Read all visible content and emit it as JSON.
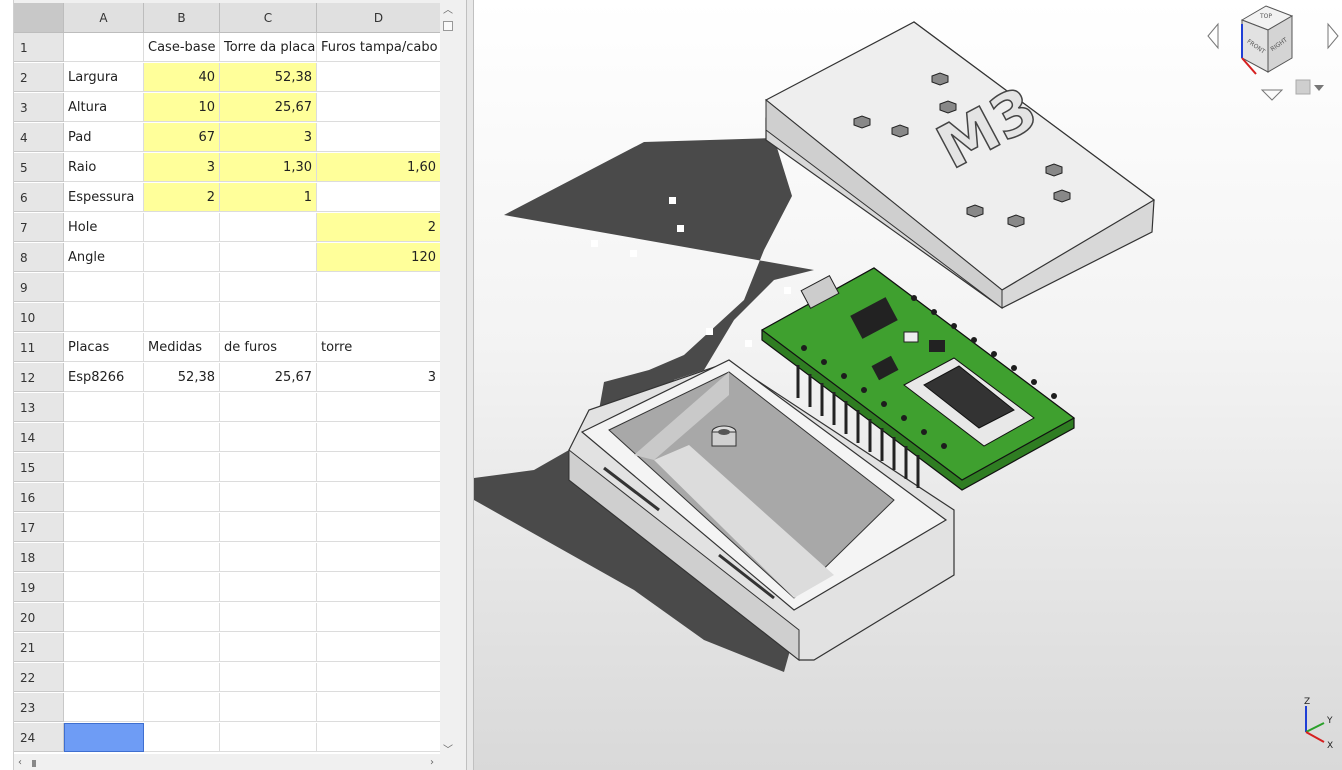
{
  "spreadsheet": {
    "columns": [
      "A",
      "B",
      "C",
      "D"
    ],
    "rows": [
      {
        "n": "1",
        "a": "",
        "b": "Case-base",
        "c": "Torre da placa",
        "d": "Furos tampa/cabo"
      },
      {
        "n": "2",
        "a": "Largura",
        "b": "40",
        "c": "52,38",
        "d": ""
      },
      {
        "n": "3",
        "a": "Altura",
        "b": "10",
        "c": "25,67",
        "d": ""
      },
      {
        "n": "4",
        "a": "Pad",
        "b": "67",
        "c": "3",
        "d": ""
      },
      {
        "n": "5",
        "a": "Raio",
        "b": "3",
        "c": "1,30",
        "d": "1,60"
      },
      {
        "n": "6",
        "a": "Espessura",
        "b": "2",
        "c": "1",
        "d": ""
      },
      {
        "n": "7",
        "a": "Hole",
        "b": "",
        "c": "",
        "d": "2"
      },
      {
        "n": "8",
        "a": "Angle",
        "b": "",
        "c": "",
        "d": "120"
      },
      {
        "n": "9",
        "a": "",
        "b": "",
        "c": "",
        "d": ""
      },
      {
        "n": "10",
        "a": "",
        "b": "",
        "c": "",
        "d": ""
      },
      {
        "n": "11",
        "a": "Placas",
        "b": "Medidas",
        "c": "de furos",
        "d": "torre"
      },
      {
        "n": "12",
        "a": "Esp8266",
        "b": "52,38",
        "c": "25,67",
        "d": "3"
      },
      {
        "n": "13",
        "a": "",
        "b": "",
        "c": "",
        "d": ""
      },
      {
        "n": "14",
        "a": "",
        "b": "",
        "c": "",
        "d": ""
      },
      {
        "n": "15",
        "a": "",
        "b": "",
        "c": "",
        "d": ""
      },
      {
        "n": "16",
        "a": "",
        "b": "",
        "c": "",
        "d": ""
      },
      {
        "n": "17",
        "a": "",
        "b": "",
        "c": "",
        "d": ""
      },
      {
        "n": "18",
        "a": "",
        "b": "",
        "c": "",
        "d": ""
      },
      {
        "n": "19",
        "a": "",
        "b": "",
        "c": "",
        "d": ""
      },
      {
        "n": "20",
        "a": "",
        "b": "",
        "c": "",
        "d": ""
      },
      {
        "n": "21",
        "a": "",
        "b": "",
        "c": "",
        "d": ""
      },
      {
        "n": "22",
        "a": "",
        "b": "",
        "c": "",
        "d": ""
      },
      {
        "n": "23",
        "a": "",
        "b": "",
        "c": "",
        "d": ""
      },
      {
        "n": "24",
        "a": "",
        "b": "",
        "c": "",
        "d": ""
      }
    ],
    "highlight_color": "#ffff9a",
    "selection_color": "#6e9cf5",
    "selected_cell": "A24"
  },
  "view3d": {
    "lid_logo": "M3",
    "navcube_faces": {
      "top": "TOP",
      "front": "FRONT",
      "right": "RIGHT"
    },
    "axis_labels": {
      "z": "Z",
      "y": "Y",
      "x": "X"
    },
    "pcb_color": "#3fa02f",
    "shadow_color": "#4a4a4a"
  }
}
